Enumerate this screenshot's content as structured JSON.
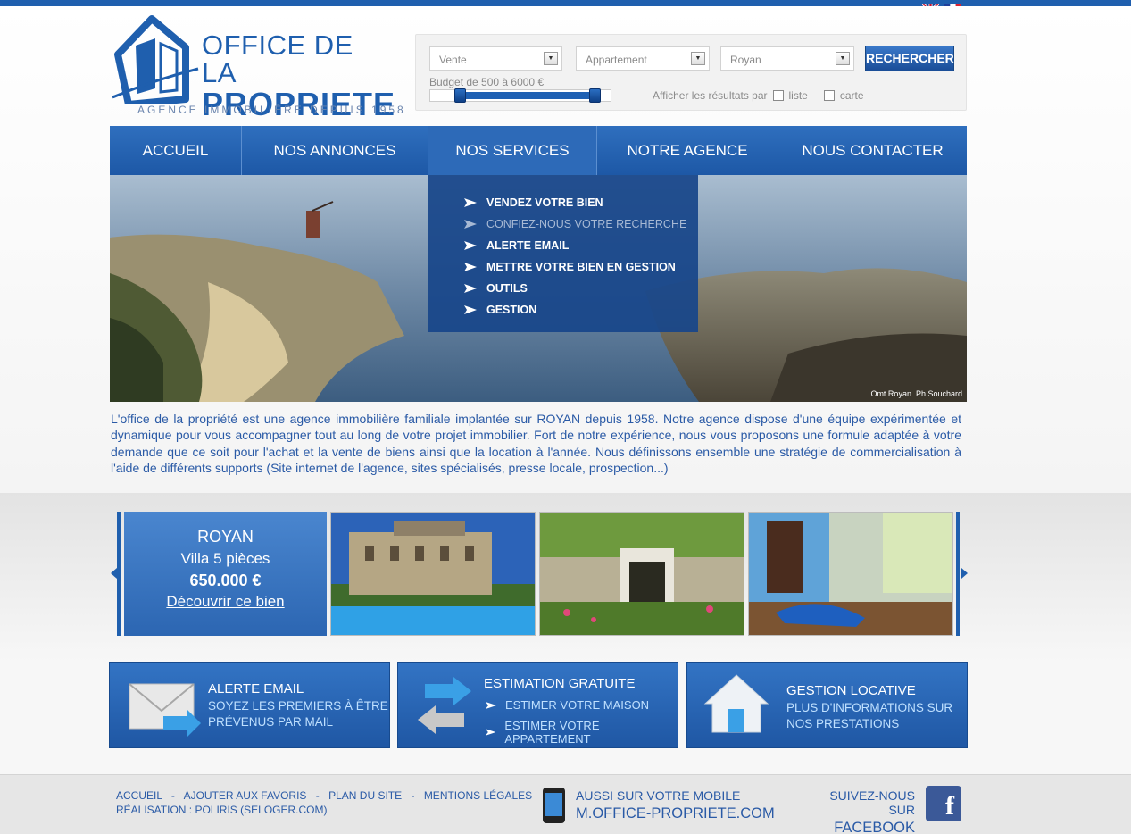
{
  "brand": {
    "title_line1": "OFFICE DE LA",
    "title_line2": "PROPRIETE",
    "tagline": "AGENCE IMMOBILIÈRE DEPUIS 1958",
    "colors": {
      "primary": "#1f5fae",
      "text": "#2a5aa6"
    }
  },
  "languages": [
    "EN",
    "FR"
  ],
  "search": {
    "transaction": "Vente",
    "property_type": "Appartement",
    "city": "Royan",
    "submit_label": "RECHERCHER",
    "budget_label": "Budget de 500 à 6000 €",
    "display_label": "Afficher les résultats par",
    "option_list": "liste",
    "option_map": "carte"
  },
  "nav": {
    "items": [
      {
        "label": "ACCUEIL"
      },
      {
        "label": "NOS ANNONCES"
      },
      {
        "label": "NOS SERVICES"
      },
      {
        "label": "NOTRE AGENCE"
      },
      {
        "label": "NOUS CONTACTER"
      }
    ],
    "active": "NOS SERVICES"
  },
  "services_menu": [
    {
      "label": "VENDEZ VOTRE BIEN"
    },
    {
      "label": "CONFIEZ-NOUS VOTRE RECHERCHE"
    },
    {
      "label": "ALERTE EMAIL"
    },
    {
      "label": "METTRE VOTRE BIEN EN GESTION"
    },
    {
      "label": "OUTILS"
    },
    {
      "label": "GESTION"
    }
  ],
  "hero": {
    "credit": "Omt Royan. Ph Souchard"
  },
  "intro": "L'office de la propriété est une agence immobilière familiale implantée sur ROYAN depuis 1958. Notre agence dispose d'une équipe expérimentée et dynamique pour vous accompagner tout au long de votre projet immobilier. Fort de notre expérience, nous vous proposons une formule adaptée à votre demande que ce soit pour l'achat et la vente de biens ainsi que la location à l'année. Nous définissons ensemble une stratégie de commercialisation à l'aide de différents supports (Site internet de l'agence, sites spécialisés, presse locale, prospection...)",
  "featured": {
    "city": "ROYAN",
    "type": "Villa 5 pièces",
    "price": "650.000 €",
    "link": "Découvrir ce bien"
  },
  "boxes": {
    "alert": {
      "title": "ALERTE EMAIL",
      "line1": "SOYEZ LES PREMIERS À ÊTRE",
      "line2": "PRÉVENUS PAR MAIL"
    },
    "estimate": {
      "title": "ESTIMATION GRATUITE",
      "link1": "ESTIMER VOTRE MAISON",
      "link2": "ESTIMER VOTRE APPARTEMENT"
    },
    "rental": {
      "title": "GESTION LOCATIVE",
      "line1": "PLUS D'INFORMATIONS SUR",
      "line2": "NOS PRESTATIONS"
    }
  },
  "footer": {
    "links": [
      "ACCUEIL",
      "AJOUTER AUX FAVORIS",
      "PLAN DU SITE",
      "MENTIONS LÉGALES"
    ],
    "separator": "-",
    "credit": "RÉALISATION : POLIRIS (SELOGER.COM)",
    "mobile_line1": "AUSSI SUR VOTRE MOBILE",
    "mobile_line2": "M.OFFICE-PROPRIETE.COM",
    "follow_line1": "SUIVEZ-NOUS SUR",
    "follow_line2": "FACEBOOK",
    "facebook_glyph": "f"
  }
}
